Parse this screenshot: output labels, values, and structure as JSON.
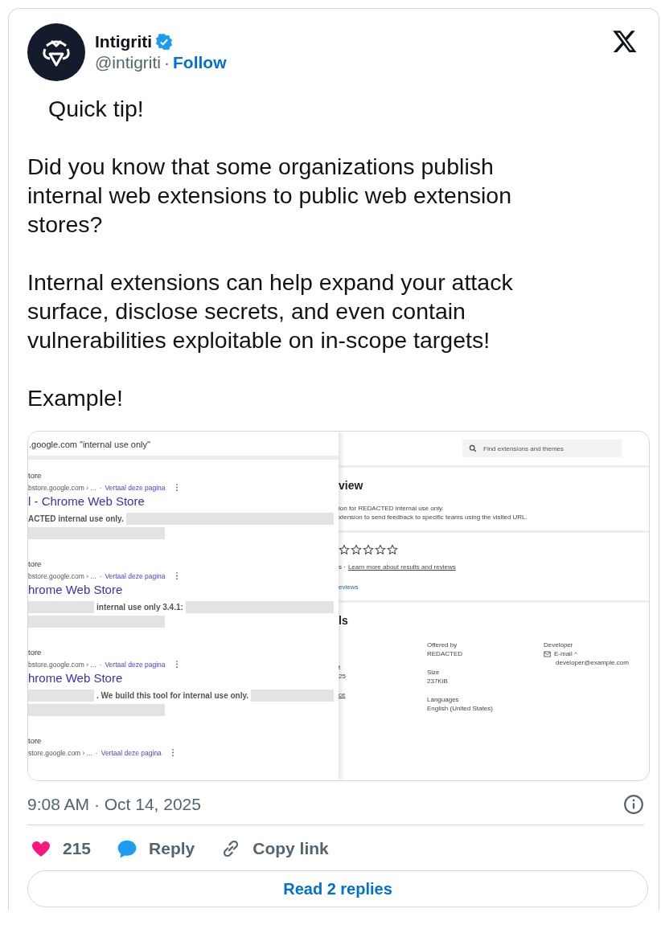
{
  "author": {
    "name": "Intigriti",
    "verified": true,
    "handle": "@intigriti",
    "separator": "·",
    "follow": "Follow"
  },
  "paragraphs": [
    "Quick tip!",
    "Did you know that some organizations publish internal web extensions to public web extension stores?",
    "Internal extensions can help expand your attack surface, disclose secrets, and even contain vulnerabilities exploitable on in-scope targets!",
    "Example!"
  ],
  "screenshot": {
    "search_results": {
      "query": ".google.com \"internal use only\"",
      "results": [
        {
          "source": "tore",
          "url": "bstore.google.com › ...",
          "separator": "·",
          "translate": "Vertaal deze pagina",
          "title": "l - Chrome Web Store",
          "lines": [
            [
              {
                "kind": "text",
                "text": "ACTED internal use only."
              },
              {
                "kind": "redacted"
              }
            ],
            [
              {
                "kind": "redacted"
              }
            ]
          ]
        },
        {
          "source": "tore",
          "url": "bstore.google.com › ...",
          "separator": "·",
          "translate": "Vertaal deze pagina",
          "title": "hrome Web Store",
          "lines": [
            [
              {
                "kind": "redacted"
              },
              {
                "kind": "text",
                "text": "internal use only 3.4.1:"
              },
              {
                "kind": "redacted"
              }
            ],
            [
              {
                "kind": "redacted"
              }
            ]
          ]
        },
        {
          "source": "tore",
          "url": "bstore.google.com › ...",
          "separator": "·",
          "translate": "Vertaal deze pagina",
          "title": "hrome Web Store",
          "lines": [
            [
              {
                "kind": "redacted"
              },
              {
                "kind": "text",
                "text": ". We build this tool for internal use only."
              },
              {
                "kind": "redacted"
              }
            ],
            [
              {
                "kind": "redacted"
              }
            ]
          ]
        },
        {
          "source": "tore",
          "url": "store.google.com › ...",
          "separator": "·",
          "translate": "Vertaal deze pagina"
        }
      ]
    },
    "store_page": {
      "search_placeholder": "Find extensions and themes",
      "overview_heading": "view",
      "description": [
        "ion for REDACTED internal use only.",
        "xtension to send feedback to specific teams using the visited URL."
      ],
      "stars": 0,
      "ratings_prefix": "s ·",
      "ratings_link": "Learn more about results and reviews",
      "reviews_link": "eviews",
      "details_heading": "ls",
      "details": [
        [
          {
            "label": "t",
            "value": "25"
          },
          {
            "label": "ce",
            "kind": "link"
          }
        ],
        [
          {
            "label": "Offered by",
            "value": "REDACTED"
          },
          {
            "label": "Size",
            "value": "237KiB"
          },
          {
            "label": "Languages",
            "value": "English (United States)"
          }
        ],
        [
          {
            "label": "Developer",
            "email": "E-mail ^",
            "value": "developer@example.com"
          }
        ]
      ]
    }
  },
  "timestamp": "9:08 AM · Oct 14, 2025",
  "likes": "215",
  "reply": "Reply",
  "copy_link": "Copy link",
  "read_replies": "Read 2 replies"
}
